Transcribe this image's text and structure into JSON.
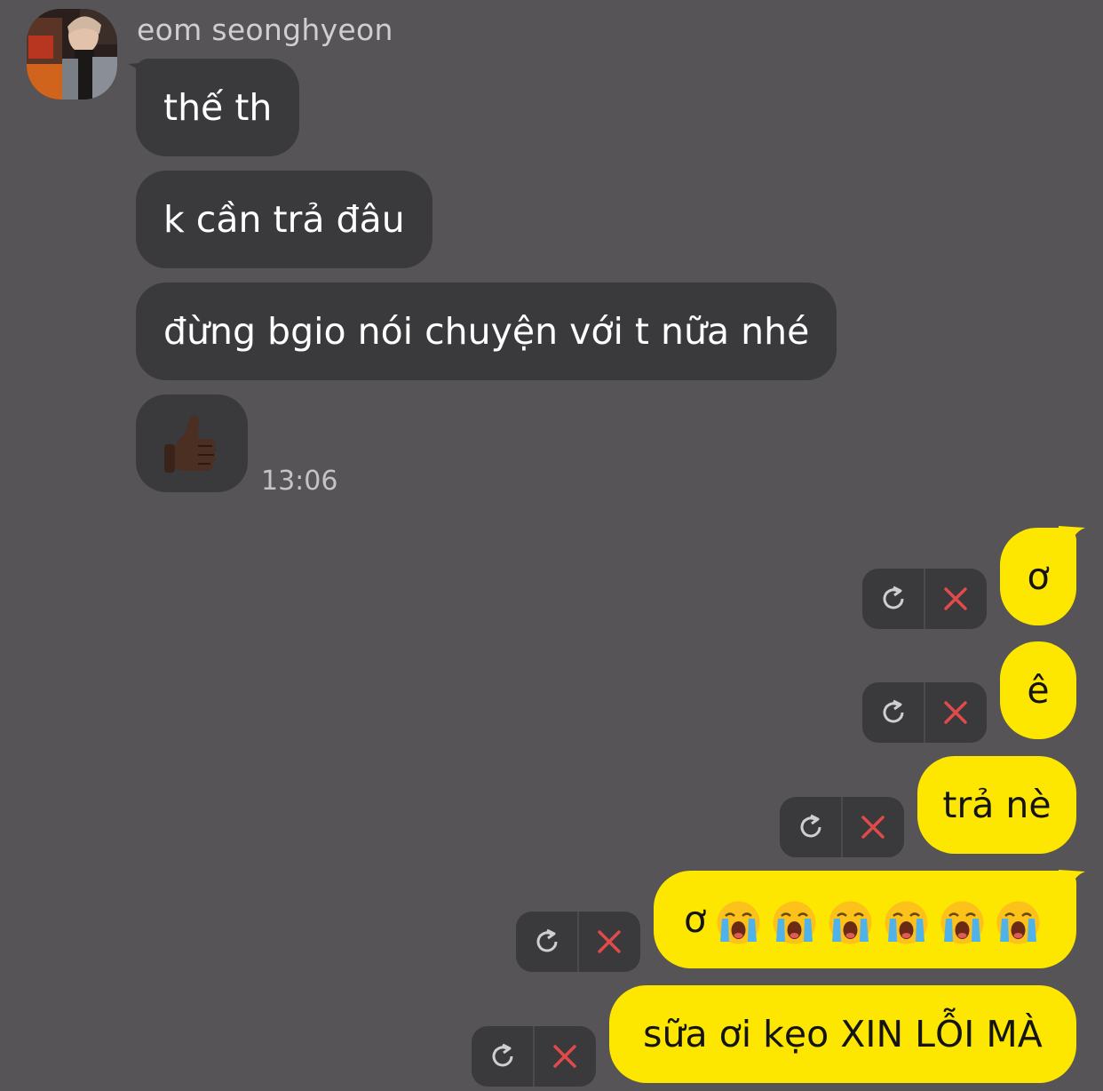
{
  "contact": {
    "name": "eom seonghyeon"
  },
  "incoming": {
    "messages": [
      {
        "text": "thế th"
      },
      {
        "text": "k cần trả đâu"
      },
      {
        "text": "đừng bgio nói chuyện với t nữa nhé"
      }
    ],
    "sticker_icon": "thumbs-up-emoji",
    "time": "13:06"
  },
  "outgoing": {
    "messages": [
      {
        "text": "ơ",
        "status": "failed"
      },
      {
        "text": "ê",
        "status": "failed"
      },
      {
        "text": "trả nè",
        "status": "failed"
      },
      {
        "text": "ơ",
        "emoji_count": 6,
        "emoji_icon": "loudly-crying-face-emoji",
        "status": "failed"
      },
      {
        "text": "sữa ơi kẹo XIN LỖI MÀ",
        "status": "failed"
      }
    ],
    "actions": {
      "retry_icon": "retry-icon",
      "delete_icon": "delete-icon"
    }
  },
  "colors": {
    "background": "#565456",
    "incoming_bubble": "#3a393b",
    "outgoing_bubble": "#fde600",
    "delete_x": "#e04a4a"
  }
}
